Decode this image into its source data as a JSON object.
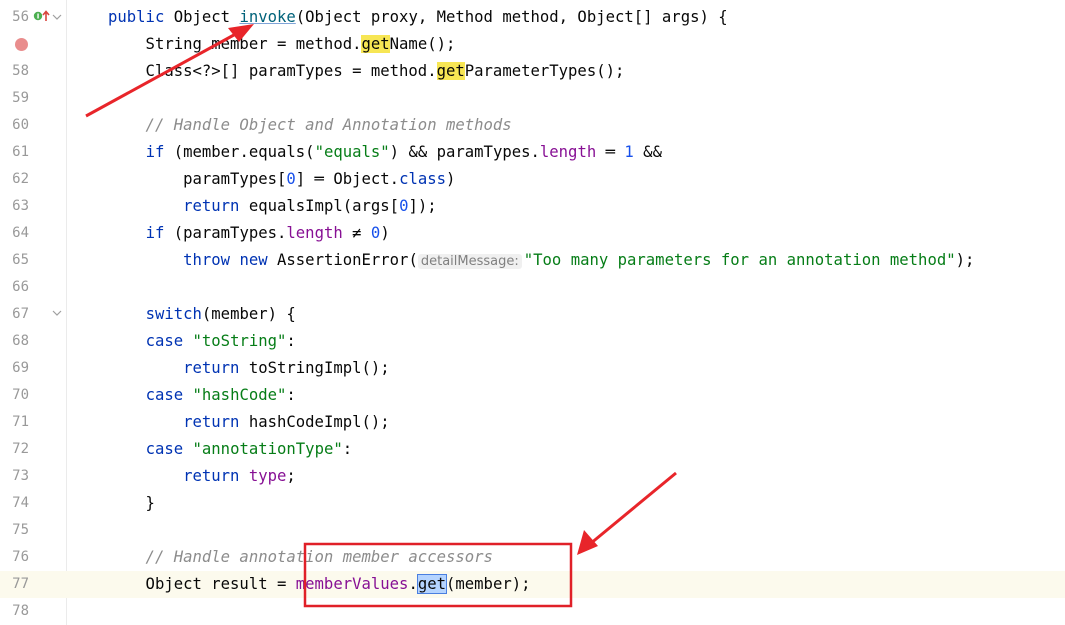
{
  "editor": {
    "lines": [
      {
        "n": "56",
        "segs": [
          {
            "t": "public ",
            "c": "kw"
          },
          {
            "t": "Object "
          },
          {
            "t": "invoke",
            "c": "fn underline"
          },
          {
            "t": "(Object proxy, Method method, Object[] args) {"
          }
        ]
      },
      {
        "n": "",
        "segs": [
          {
            "t": "    String member = method."
          },
          {
            "t": "get",
            "c": "hl"
          },
          {
            "t": "Name();"
          }
        ]
      },
      {
        "n": "58",
        "segs": [
          {
            "t": "    Class<?>[] paramTypes = method."
          },
          {
            "t": "get",
            "c": "hl"
          },
          {
            "t": "ParameterTypes();"
          }
        ]
      },
      {
        "n": "59",
        "segs": []
      },
      {
        "n": "60",
        "segs": [
          {
            "t": "    // Handle Object and Annotation methods",
            "c": "cmt"
          }
        ]
      },
      {
        "n": "61",
        "segs": [
          {
            "t": "    "
          },
          {
            "t": "if",
            "c": "kw"
          },
          {
            "t": " (member.equals("
          },
          {
            "t": "\"equals\"",
            "c": "str"
          },
          {
            "t": ") && paramTypes."
          },
          {
            "t": "length",
            "c": "fld"
          },
          {
            "t": " ═ "
          },
          {
            "t": "1",
            "c": "num"
          },
          {
            "t": " &&"
          }
        ]
      },
      {
        "n": "62",
        "segs": [
          {
            "t": "        paramTypes["
          },
          {
            "t": "0",
            "c": "num"
          },
          {
            "t": "] ═ Object."
          },
          {
            "t": "class",
            "c": "kw"
          },
          {
            "t": ")"
          }
        ]
      },
      {
        "n": "63",
        "segs": [
          {
            "t": "        "
          },
          {
            "t": "return",
            "c": "kw"
          },
          {
            "t": " equalsImpl(args["
          },
          {
            "t": "0",
            "c": "num"
          },
          {
            "t": "]);"
          }
        ]
      },
      {
        "n": "64",
        "segs": [
          {
            "t": "    "
          },
          {
            "t": "if",
            "c": "kw"
          },
          {
            "t": " (paramTypes."
          },
          {
            "t": "length",
            "c": "fld"
          },
          {
            "t": " ≠ "
          },
          {
            "t": "0",
            "c": "num"
          },
          {
            "t": ")"
          }
        ]
      },
      {
        "n": "65",
        "segs": [
          {
            "t": "        "
          },
          {
            "t": "throw",
            "c": "kw"
          },
          {
            "t": " "
          },
          {
            "t": "new",
            "c": "kw"
          },
          {
            "t": " AssertionError("
          },
          {
            "t": "detailMessage:",
            "c": "hint"
          },
          {
            "t": "\"Too many parameters for an annotation method\"",
            "c": "str"
          },
          {
            "t": ");"
          }
        ]
      },
      {
        "n": "66",
        "segs": []
      },
      {
        "n": "67",
        "segs": [
          {
            "t": "    "
          },
          {
            "t": "switch",
            "c": "kw"
          },
          {
            "t": "(member) {"
          }
        ]
      },
      {
        "n": "68",
        "segs": [
          {
            "t": "    "
          },
          {
            "t": "case",
            "c": "kw"
          },
          {
            "t": " "
          },
          {
            "t": "\"toString\"",
            "c": "str"
          },
          {
            "t": ":"
          }
        ]
      },
      {
        "n": "69",
        "segs": [
          {
            "t": "        "
          },
          {
            "t": "return",
            "c": "kw"
          },
          {
            "t": " toStringImpl();"
          }
        ]
      },
      {
        "n": "70",
        "segs": [
          {
            "t": "    "
          },
          {
            "t": "case",
            "c": "kw"
          },
          {
            "t": " "
          },
          {
            "t": "\"hashCode\"",
            "c": "str"
          },
          {
            "t": ":"
          }
        ]
      },
      {
        "n": "71",
        "segs": [
          {
            "t": "        "
          },
          {
            "t": "return",
            "c": "kw"
          },
          {
            "t": " hashCodeImpl();"
          }
        ]
      },
      {
        "n": "72",
        "segs": [
          {
            "t": "    "
          },
          {
            "t": "case",
            "c": "kw"
          },
          {
            "t": " "
          },
          {
            "t": "\"annotationType\"",
            "c": "str"
          },
          {
            "t": ":"
          }
        ]
      },
      {
        "n": "73",
        "segs": [
          {
            "t": "        "
          },
          {
            "t": "return",
            "c": "kw"
          },
          {
            "t": " "
          },
          {
            "t": "type",
            "c": "fld"
          },
          {
            "t": ";"
          }
        ]
      },
      {
        "n": "74",
        "segs": [
          {
            "t": "    }"
          }
        ]
      },
      {
        "n": "75",
        "segs": []
      },
      {
        "n": "76",
        "segs": [
          {
            "t": "    // Handle annotation member accessors",
            "c": "cmt"
          }
        ]
      },
      {
        "n": "77",
        "segs": [
          {
            "t": "    Object result = "
          },
          {
            "t": "memberValues",
            "c": "fld"
          },
          {
            "t": "."
          },
          {
            "t": "get",
            "c": "hlsel"
          },
          {
            "t": "(member);"
          }
        ]
      },
      {
        "n": "78",
        "segs": []
      }
    ],
    "current_line": "77"
  },
  "gutter": {
    "breakpoint_icon": "breakpoint-icon",
    "implements_icon": "implements-method-icon",
    "fold_icon": "fold-chevron-icon"
  },
  "annotations": {
    "arrow_color": "#e8252a",
    "box_color": "#e02028"
  }
}
